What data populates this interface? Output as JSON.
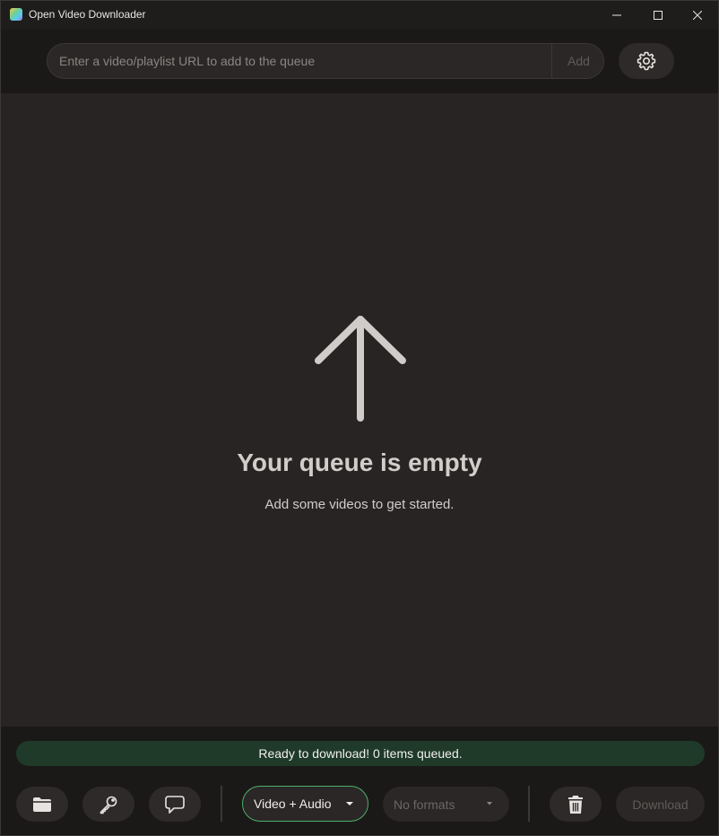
{
  "window": {
    "title": "Open Video Downloader"
  },
  "toolbar": {
    "url_placeholder": "Enter a video/playlist URL to add to the queue",
    "url_value": "",
    "add_label": "Add",
    "settings_icon": "gear-icon"
  },
  "queue": {
    "empty_icon": "arrow-up-icon",
    "empty_title": "Your queue is empty",
    "empty_subtitle": "Add some videos to get started."
  },
  "status": {
    "message": "Ready to download! 0 items queued."
  },
  "bottom": {
    "folder_icon": "folder-icon",
    "key_icon": "key-icon",
    "comment_icon": "comment-icon",
    "format_selected": "Video + Audio",
    "quality_selected": "No formats",
    "trash_icon": "trash-icon",
    "download_label": "Download"
  },
  "colors": {
    "accent_green": "#4caf6a",
    "status_bg": "#1f3a28",
    "main_bg": "#272423",
    "chrome_bg": "#1b1918"
  }
}
